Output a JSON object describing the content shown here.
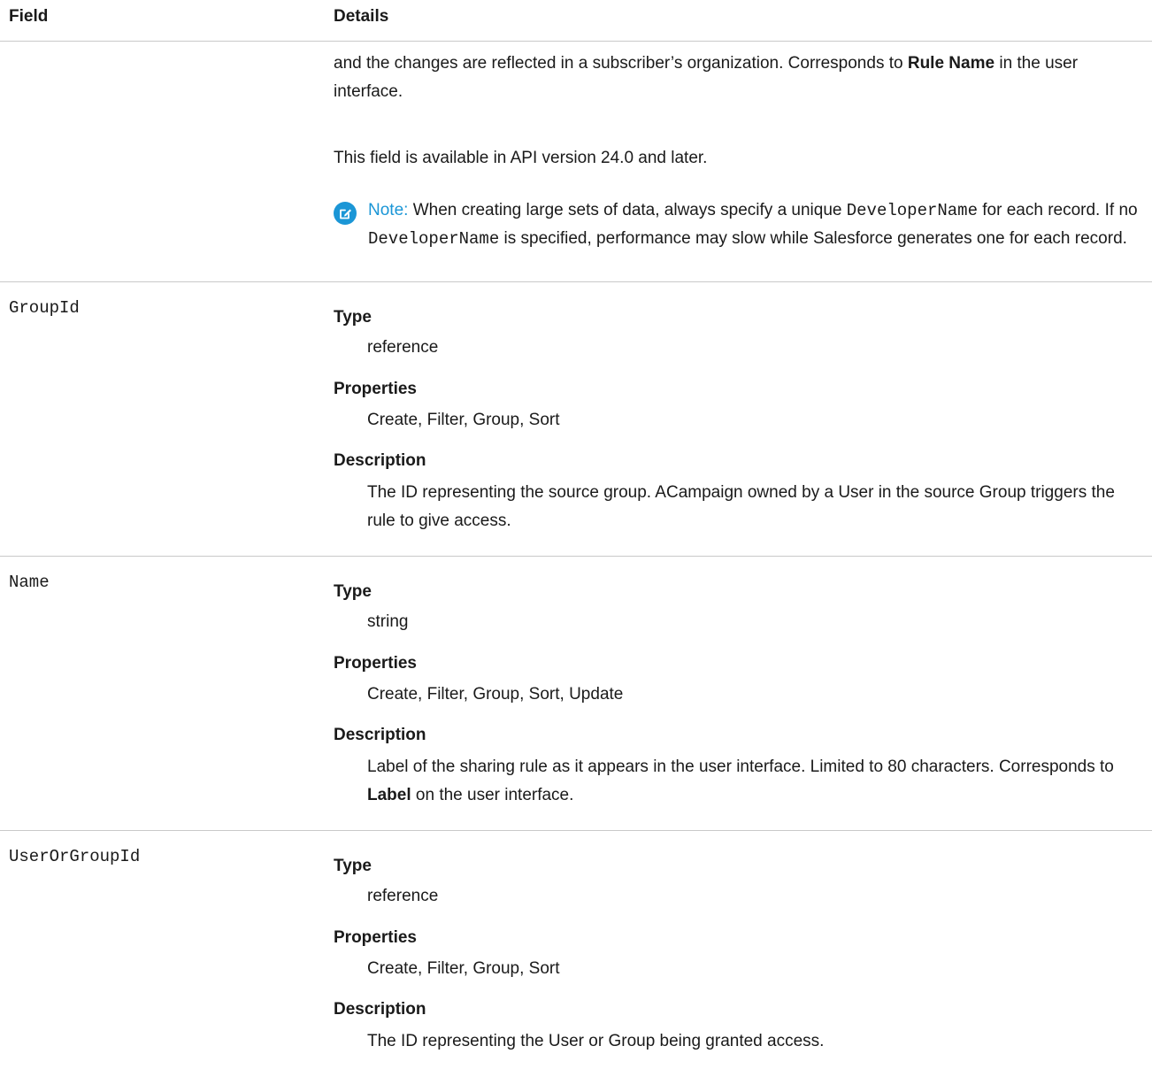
{
  "header": {
    "field": "Field",
    "details": "Details"
  },
  "intro": {
    "line1_prefix": "and the changes are reflected in a subscriber’s organization. Corresponds to ",
    "line1_bold": "Rule Name",
    "line1_suffix": " in the user interface.",
    "availability": "This field is available in API version 24.0 and later.",
    "note": {
      "label": "Note:",
      "t1": " When creating large sets of data, always specify a unique ",
      "code1": "DeveloperName",
      "t2": " for each record. If no ",
      "code2": "DeveloperName",
      "t3": " is specified, performance may slow while Salesforce generates one for each record."
    }
  },
  "labels": {
    "type": "Type",
    "properties": "Properties",
    "description": "Description"
  },
  "fields": [
    {
      "name": "GroupId",
      "type": "reference",
      "properties": "Create, Filter, Group, Sort",
      "description": "The ID representing the source group. ACampaign owned by a User in the source Group triggers the rule to give access."
    },
    {
      "name": "Name",
      "type": "string",
      "properties": "Create, Filter, Group, Sort, Update",
      "description_prefix": "Label of the sharing rule as it appears in the user interface. Limited to 80 characters. Corresponds to ",
      "description_bold": "Label",
      "description_suffix": " on the user interface."
    },
    {
      "name": "UserOrGroupId",
      "type": "reference",
      "properties": "Create, Filter, Group, Sort",
      "description": "The ID representing the User or Group being granted access."
    }
  ],
  "colors": {
    "accent": "#1b96d6",
    "divider": "#c9c9c9"
  },
  "icons": {
    "note": "edit-note-icon"
  }
}
